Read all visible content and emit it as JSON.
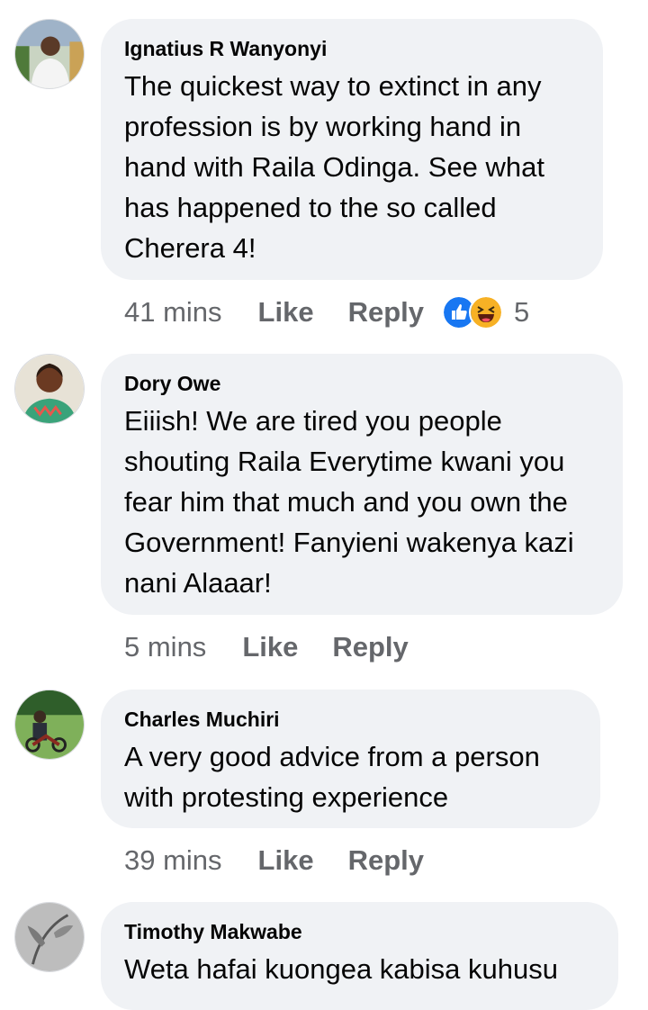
{
  "comments": [
    {
      "author": "Ignatius R Wanyonyi",
      "text": "The quickest way to extinct in any profession is by working hand in hand with Raila Odinga. See what has happened to the so called Cherera 4!",
      "time": "41 mins",
      "like_label": "Like",
      "reply_label": "Reply",
      "reactions": [
        "like-icon",
        "haha-icon"
      ],
      "reaction_count": "5"
    },
    {
      "author": "Dory Owe",
      "text": "Eiiish! We are tired you people shouting Raila Everytime kwani you fear him that much and you own the Government! Fanyieni wakenya kazi nani Alaaar!",
      "time": "5 mins",
      "like_label": "Like",
      "reply_label": "Reply"
    },
    {
      "author": "Charles Muchiri",
      "text": "A very good advice from a person with protesting experience",
      "time": "39 mins",
      "like_label": "Like",
      "reply_label": "Reply"
    },
    {
      "author": "Timothy Makwabe",
      "text": "Weta hafai kuongea kabisa kuhusu"
    }
  ],
  "colors": {
    "bubble": "#f0f2f5",
    "action_text": "#65676b",
    "like_blue": "#1877f2",
    "haha_yellow": "#f7b125"
  }
}
